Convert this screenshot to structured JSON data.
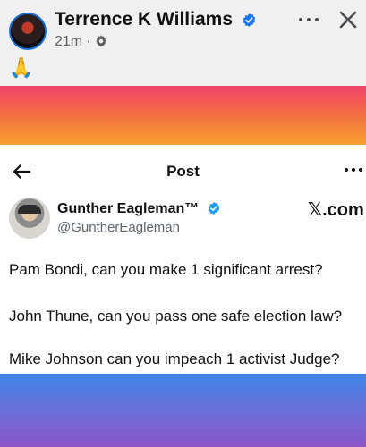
{
  "facebook_post": {
    "author_name": "Terrence K Williams",
    "timestamp": "21m",
    "separator": "·",
    "audience_icon": "gear-icon",
    "verified_icon": "verified-badge-icon",
    "more_icon": "more-horizontal-icon",
    "close_icon": "close-icon",
    "body_text": "🙏",
    "colors": {
      "verified": "#1877f2",
      "band_top": [
        "#f0446a",
        "#f36a43",
        "#f7a030"
      ],
      "band_bottom": [
        "#3d86e8",
        "#6a6fd8",
        "#8b55c7"
      ]
    }
  },
  "x_screenshot": {
    "header_title": "Post",
    "back_icon": "arrow-left-icon",
    "more_icon": "more-horizontal-icon",
    "author_name": "Gunther Eagleman™",
    "author_handle": "@GuntherEagleman",
    "verified_icon": "verified-badge-icon",
    "brand": "𝕏.com",
    "lines": [
      "Pam Bondi, can you make 1 significant arrest?",
      "John Thune, can you pass one safe election law?",
      "Mike Johnson can you impeach 1 activist Judge?"
    ]
  }
}
